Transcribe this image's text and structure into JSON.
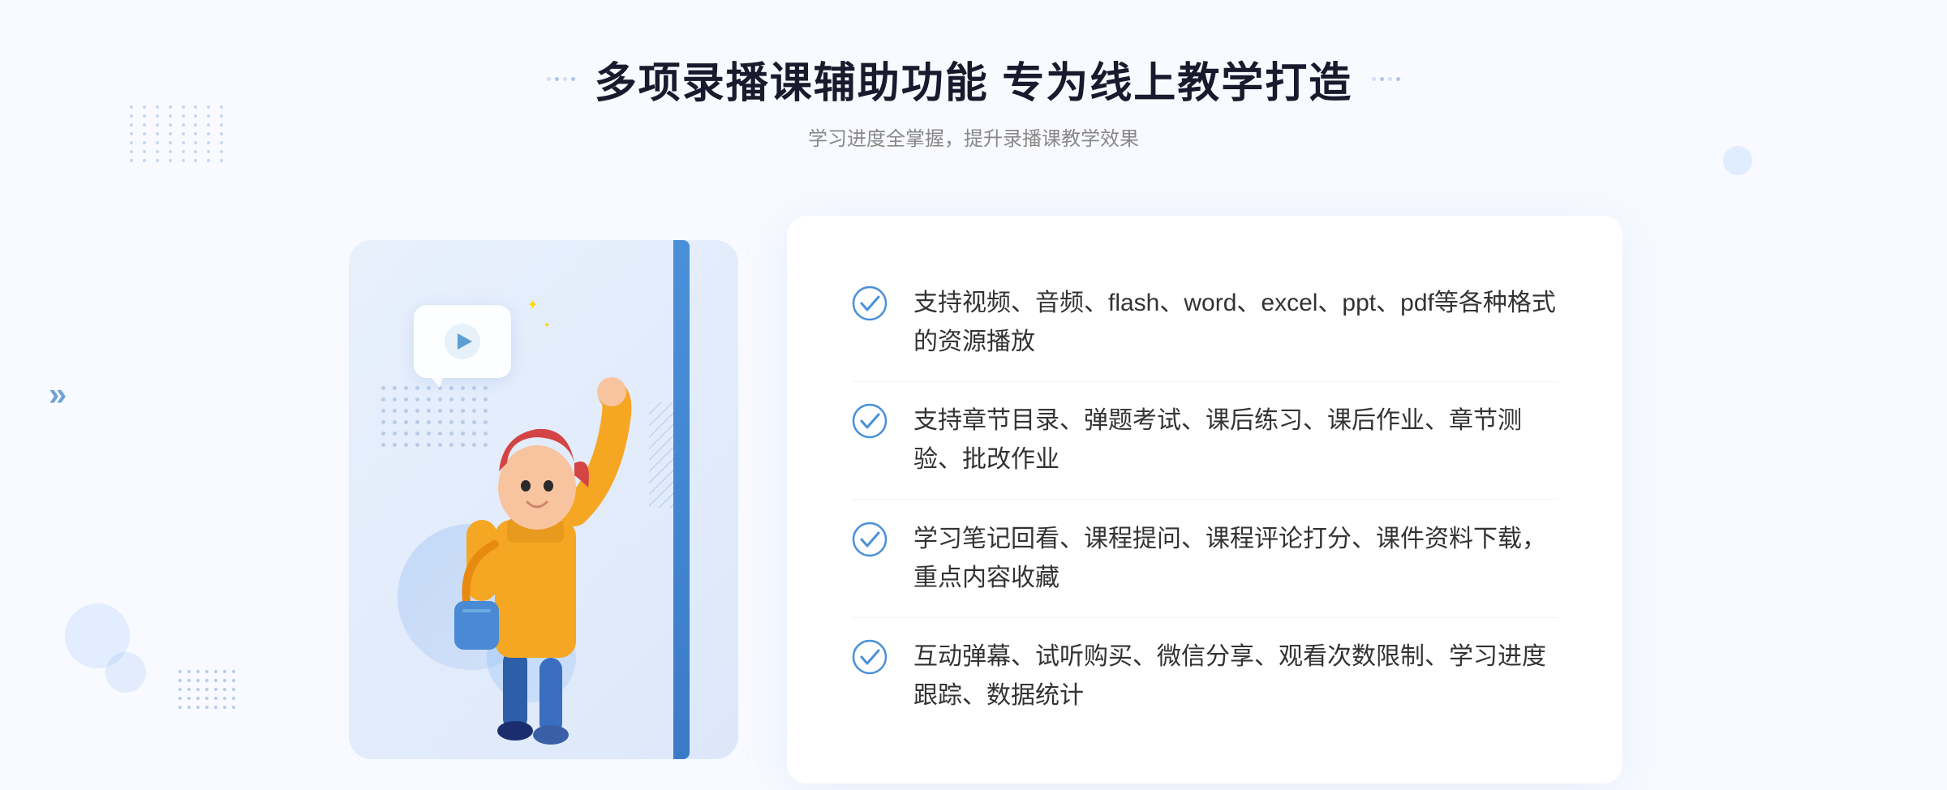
{
  "page": {
    "background_color": "#f7faff"
  },
  "header": {
    "title": "多项录播课辅助功能 专为线上教学打造",
    "subtitle": "学习进度全掌握，提升录播课教学效果",
    "decorator_left": "⁞⁞",
    "decorator_right": "⁞⁞"
  },
  "features": [
    {
      "id": 1,
      "text": "支持视频、音频、flash、word、excel、ppt、pdf等各种格式的资源播放"
    },
    {
      "id": 2,
      "text": "支持章节目录、弹题考试、课后练习、课后作业、章节测验、批改作业"
    },
    {
      "id": 3,
      "text": "学习笔记回看、课程提问、课程评论打分、课件资料下载，重点内容收藏"
    },
    {
      "id": 4,
      "text": "互动弹幕、试听购买、微信分享、观看次数限制、学习进度跟踪、数据统计"
    }
  ],
  "icons": {
    "check_circle": "check-circle-icon",
    "play": "play-icon",
    "arrow": "arrow-icon"
  },
  "colors": {
    "primary": "#4a90d9",
    "primary_dark": "#3a7bc8",
    "text_dark": "#1a1a2e",
    "text_gray": "#888888",
    "text_feature": "#333333",
    "bg_light": "#f7faff",
    "card_bg": "#e8f0fc"
  }
}
